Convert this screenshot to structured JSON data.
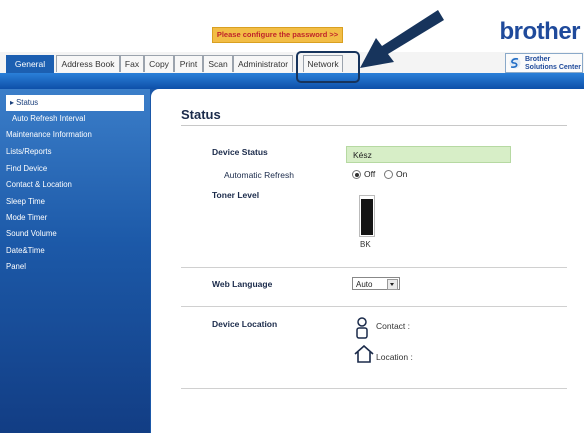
{
  "banner": {
    "text": "Please configure the password >>"
  },
  "brand": {
    "logo_text": "brother"
  },
  "tabs": [
    {
      "label": "General",
      "active": true
    },
    {
      "label": "Address Book",
      "active": false
    },
    {
      "label": "Fax",
      "active": false
    },
    {
      "label": "Copy",
      "active": false
    },
    {
      "label": "Print",
      "active": false
    },
    {
      "label": "Scan",
      "active": false
    },
    {
      "label": "Administrator",
      "active": false
    },
    {
      "label": "Network",
      "active": false
    }
  ],
  "solutions_center": {
    "line1": "Brother",
    "line2": "Solutions Center"
  },
  "sidebar": {
    "items": [
      {
        "label": "▸ Status",
        "active": true,
        "sub": false
      },
      {
        "label": "Auto Refresh Interval",
        "active": false,
        "sub": true
      },
      {
        "label": "Maintenance Information",
        "active": false,
        "sub": false
      },
      {
        "label": "Lists/Reports",
        "active": false,
        "sub": false
      },
      {
        "label": "Find Device",
        "active": false,
        "sub": false
      },
      {
        "label": "Contact & Location",
        "active": false,
        "sub": false
      },
      {
        "label": "Sleep Time",
        "active": false,
        "sub": false
      },
      {
        "label": "Mode Timer",
        "active": false,
        "sub": false
      },
      {
        "label": "Sound Volume",
        "active": false,
        "sub": false
      },
      {
        "label": "Date&Time",
        "active": false,
        "sub": false
      },
      {
        "label": "Panel",
        "active": false,
        "sub": false
      }
    ]
  },
  "main": {
    "title": "Status",
    "device_status_label": "Device Status",
    "device_status_value": "Kész",
    "auto_refresh_label": "Automatic Refresh",
    "auto_refresh_options": [
      {
        "label": "Off",
        "selected": true
      },
      {
        "label": "On",
        "selected": false
      }
    ],
    "toner_label": "Toner Level",
    "toner": {
      "color_label": "BK",
      "level_fraction": 0.95,
      "color": "#151515"
    },
    "web_language_label": "Web Language",
    "web_language_value": "Auto",
    "device_location_label": "Device Location",
    "contact_label": "Contact :",
    "location_label": "Location :"
  },
  "colors": {
    "accent_blue": "#1c5fb1",
    "banner_bg": "#f2bd46",
    "banner_text": "#c0252a",
    "status_bg": "#d7eec7",
    "annotation": "#17345c"
  }
}
